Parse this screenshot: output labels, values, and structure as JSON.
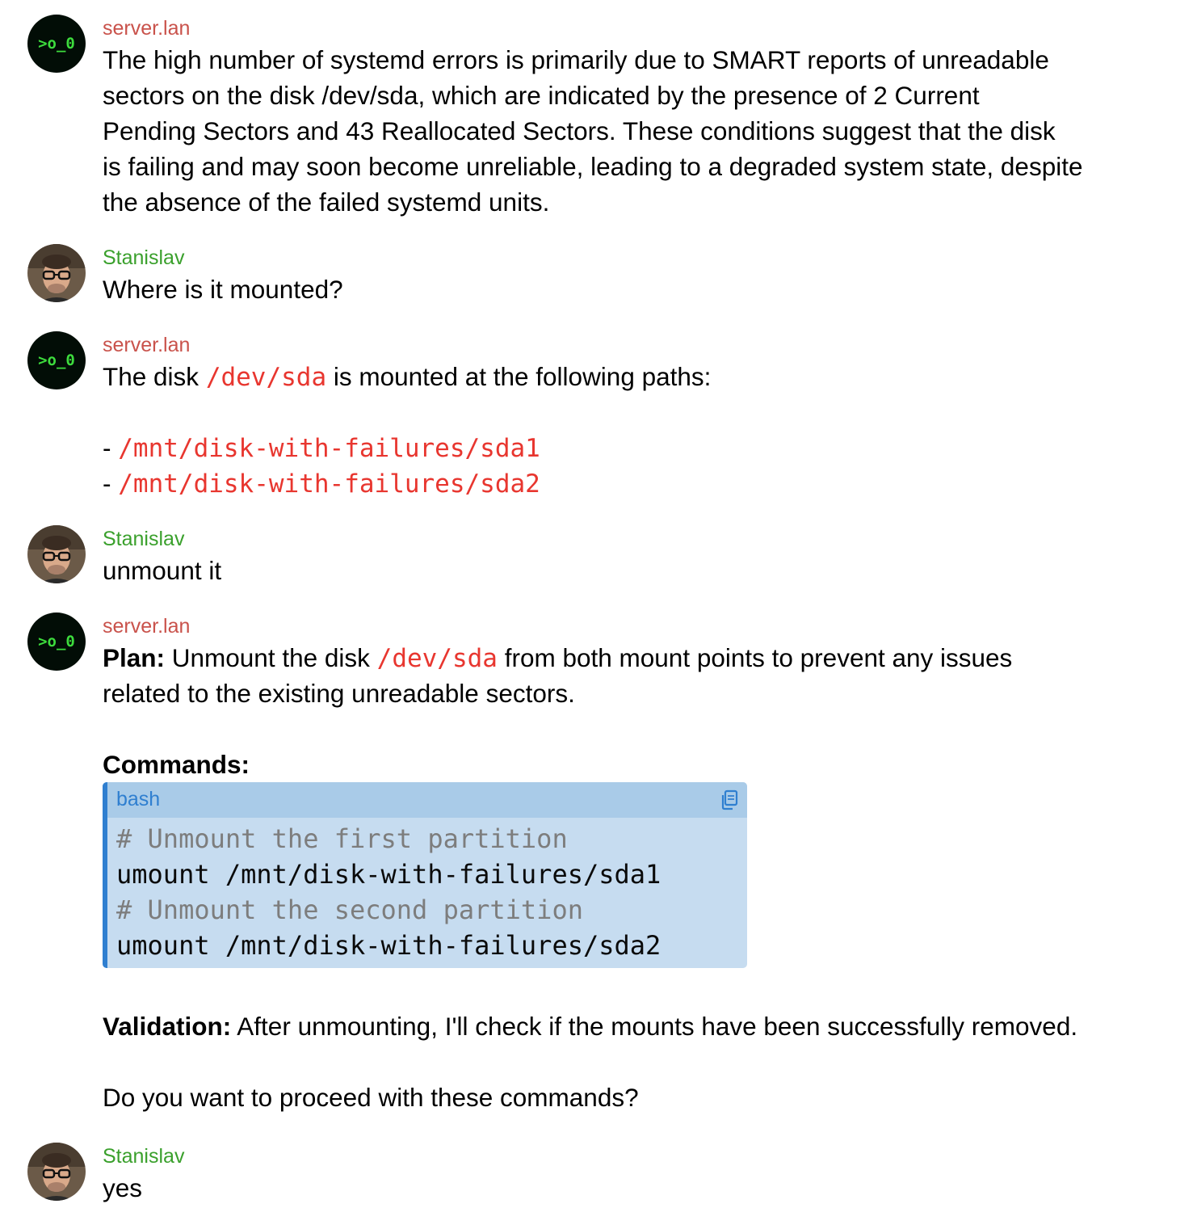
{
  "messages": [
    {
      "sender": "server.lan",
      "avatar_text": ">o_0",
      "lines": [
        "The high number of systemd errors is primarily due to SMART reports of unreadable",
        "sectors on the disk /dev/sda, which are indicated by the presence of 2 Current",
        "Pending Sectors and 43 Reallocated Sectors. These conditions suggest that the disk",
        "is failing and may soon become unreliable, leading to a degraded system state, despite",
        "the absence of the failed systemd units."
      ]
    },
    {
      "sender": "Stanislav",
      "text": "Where is it mounted?"
    },
    {
      "sender": "server.lan",
      "avatar_text": ">o_0",
      "intro_before": "The disk ",
      "intro_code": "/dev/sda",
      "intro_after": " is mounted at the following paths:",
      "list_bullet": "- ",
      "paths": [
        "/mnt/disk-with-failures/sda1",
        "/mnt/disk-with-failures/sda2"
      ]
    },
    {
      "sender": "Stanislav",
      "text": "unmount it"
    },
    {
      "sender": "server.lan",
      "avatar_text": ">o_0",
      "plan_label": "Plan:",
      "plan_before": " Unmount the disk ",
      "plan_code": "/dev/sda",
      "plan_after": " from both mount points to prevent any issues",
      "plan_line2": "related to the existing unreadable sectors.",
      "commands_label": "Commands:",
      "code_block": {
        "language": "bash",
        "copy_icon": "copy-icon",
        "lines": [
          "# Unmount the first partition",
          "umount /mnt/disk-with-failures/sda1",
          "# Unmount the second partition",
          "umount /mnt/disk-with-failures/sda2"
        ]
      },
      "validation_label": "Validation:",
      "validation_text": " After unmounting, I'll check if the mounts have been successfully removed.",
      "question": "Do you want to proceed with these commands?"
    },
    {
      "sender": "Stanislav",
      "text": "yes"
    }
  ],
  "colors": {
    "bot_name": "#c9524b",
    "user_name": "#3aa02c",
    "inline_code": "#e8362f",
    "code_bg": "#c6dcf0",
    "code_header_bg": "#a9cbe8",
    "code_accent": "#2f7fd0"
  }
}
